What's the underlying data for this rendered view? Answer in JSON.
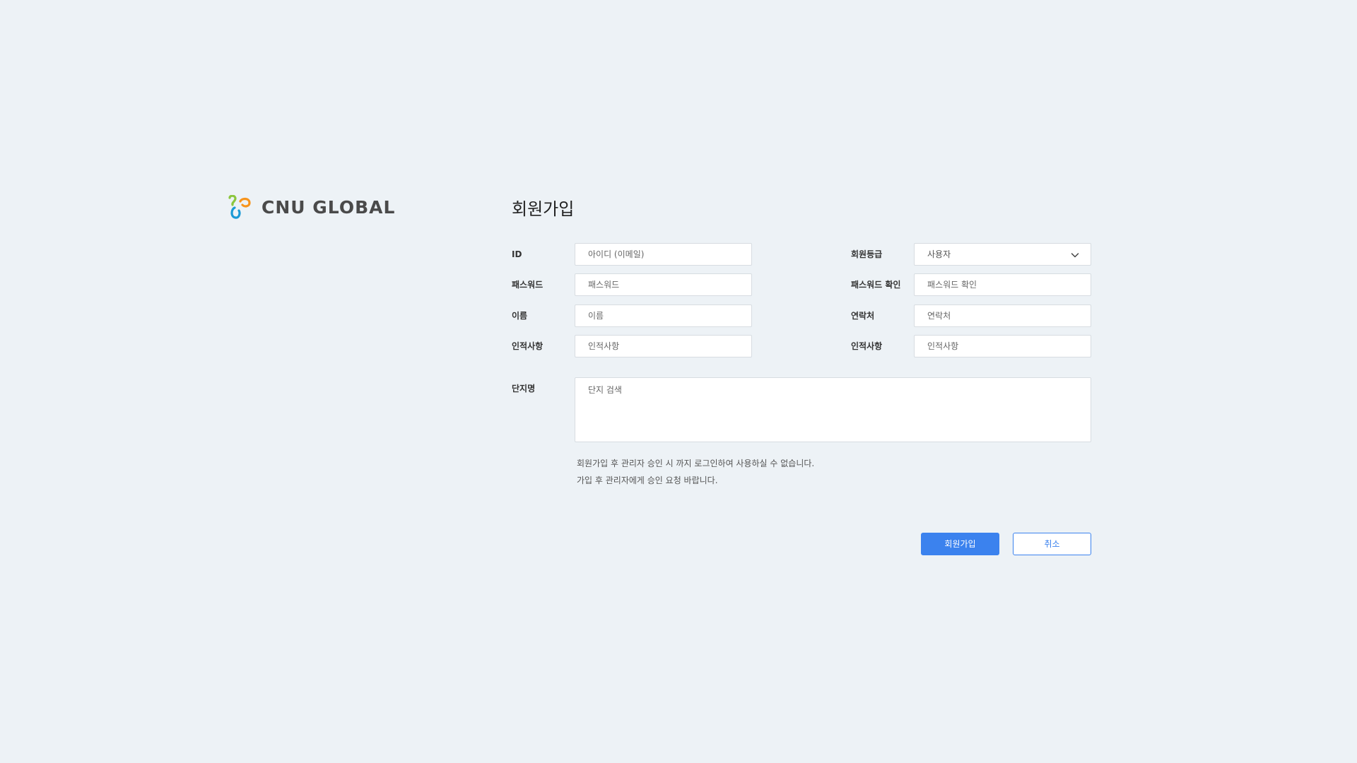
{
  "logo": {
    "text": "CNU GLOBAL",
    "icon": "cnu-trefoil-logo",
    "colors": [
      "#8cc63f",
      "#f7941d",
      "#1b9ad6"
    ]
  },
  "page_title": "회원가입",
  "fields": {
    "id": {
      "label": "ID",
      "placeholder": "아이디 (이메일)"
    },
    "grade": {
      "label": "회원등급",
      "value": "사용자",
      "icon": "chevron-down-icon"
    },
    "password": {
      "label": "패스워드",
      "placeholder": "패스워드"
    },
    "password_confirm": {
      "label": "패스워드 확인",
      "placeholder": "패스워드 확인"
    },
    "name": {
      "label": "이름",
      "placeholder": "이름"
    },
    "contact": {
      "label": "연락처",
      "placeholder": "연락처"
    },
    "info_left": {
      "label": "인적사항",
      "placeholder": "인적사항"
    },
    "info_right": {
      "label": "인적사항",
      "placeholder": "인적사항"
    },
    "complex": {
      "label": "단지명",
      "placeholder": "단지 검색"
    }
  },
  "notice": {
    "line1": "회원가입 후 관리자 승인 시 까지 로그인하여 사용하실 수 없습니다.",
    "line2": "가입 후 관리자에게 승인 요청 바랍니다."
  },
  "buttons": {
    "submit": "회원가입",
    "cancel": "취소"
  },
  "colors": {
    "background": "#edf2f6",
    "accent": "#3b82ee",
    "input_border": "#d7dce1"
  }
}
